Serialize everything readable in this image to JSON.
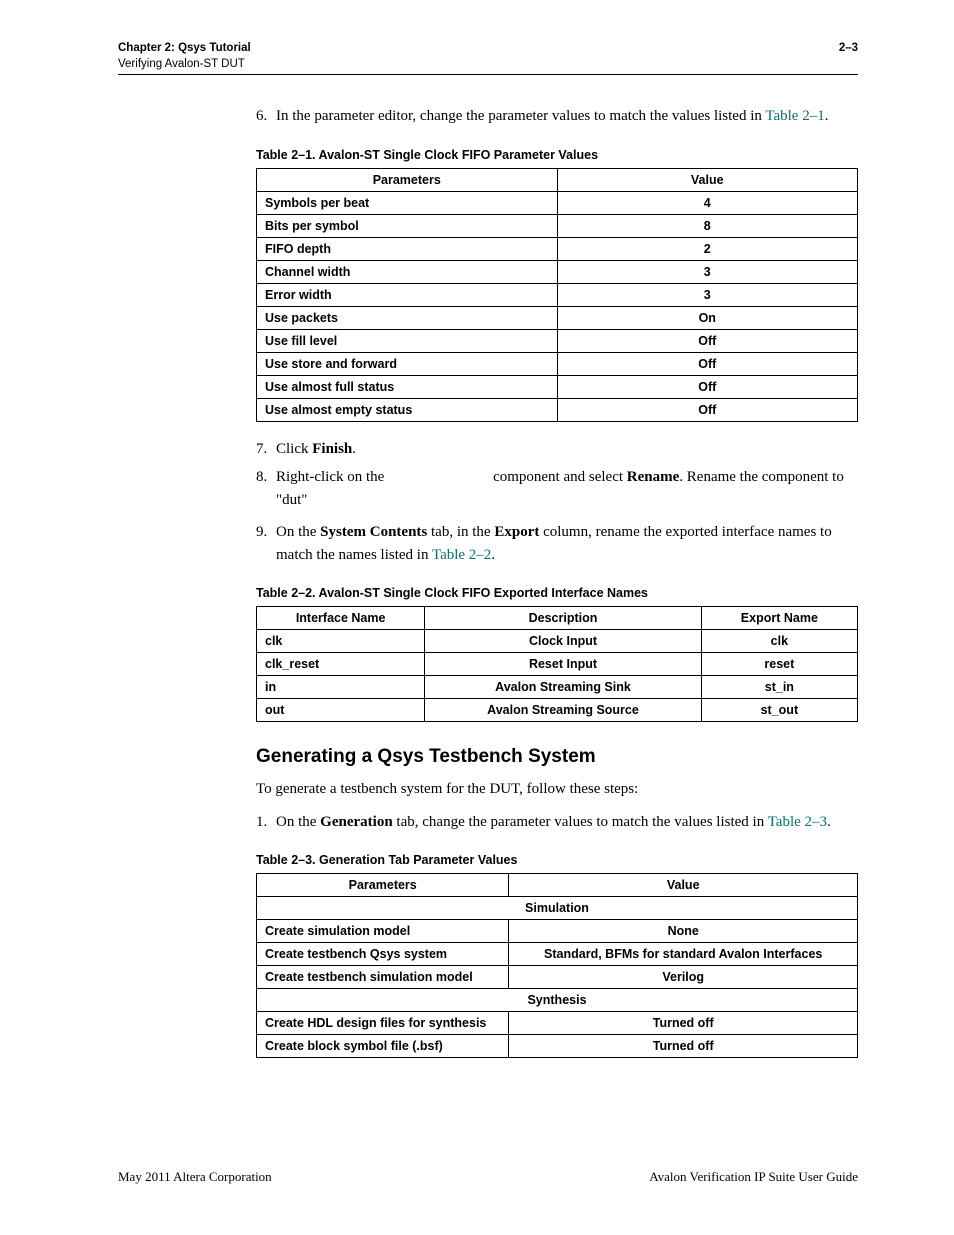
{
  "header": {
    "chapter_line": "Chapter 2: Qsys Tutorial",
    "sub_line": "Verifying Avalon-ST DUT",
    "page_number": "2–3"
  },
  "step6": {
    "num": "6.",
    "text_a": "In the parameter editor, change the parameter values to match the values listed in ",
    "link": "Table 2–1",
    "text_b": "."
  },
  "table1": {
    "caption": "Table 2–1.  Avalon-ST Single Clock FIFO Parameter Values",
    "headers": {
      "c1": "Parameters",
      "c2": "Value"
    },
    "rows": [
      {
        "param": "Symbols per beat",
        "value": "4"
      },
      {
        "param": "Bits per symbol",
        "value": "8"
      },
      {
        "param": "FIFO depth",
        "value": "2"
      },
      {
        "param": "Channel width",
        "value": "3"
      },
      {
        "param": "Error width",
        "value": "3"
      },
      {
        "param": "Use packets",
        "value": "On"
      },
      {
        "param": "Use fill level",
        "value": "Off"
      },
      {
        "param": "Use store and forward",
        "value": "Off"
      },
      {
        "param": "Use almost full status",
        "value": "Off"
      },
      {
        "param": "Use almost empty status",
        "value": "Off"
      }
    ]
  },
  "step7": {
    "num": "7.",
    "text_a": "Click ",
    "bold": "Finish",
    "text_b": "."
  },
  "step8": {
    "num": "8.",
    "text_a": "Right-click on the ",
    "gap": "                           ",
    "text_b": " component and select ",
    "bold": "Rename",
    "text_c": ". Rename the component to \"dut\""
  },
  "step9": {
    "num": "9.",
    "text_a": "On the ",
    "bold1": "System Contents",
    "text_b": " tab, in the ",
    "bold2": "Export",
    "text_c": " column, rename the exported interface names to match the names listed in ",
    "link": "Table 2–2",
    "text_d": "."
  },
  "table2": {
    "caption": "Table 2–2.  Avalon-ST Single Clock FIFO Exported Interface Names",
    "headers": {
      "c1": "Interface Name",
      "c2": "Description",
      "c3": "Export Name"
    },
    "rows": [
      {
        "iface": "clk",
        "desc": "Clock Input",
        "export": "clk"
      },
      {
        "iface": "clk_reset",
        "desc": "Reset Input",
        "export": "reset"
      },
      {
        "iface": "in",
        "desc": "Avalon Streaming Sink",
        "export": "st_in"
      },
      {
        "iface": "out",
        "desc": "Avalon Streaming Source",
        "export": "st_out"
      }
    ]
  },
  "section": {
    "heading": "Generating a Qsys Testbench System",
    "intro": "To generate a testbench system for the DUT, follow these steps:"
  },
  "step1b": {
    "num": "1.",
    "text_a": "On the ",
    "bold": "Generation",
    "text_b": " tab, change the parameter values to match the values listed in ",
    "link": "Table 2–3",
    "text_c": "."
  },
  "table3": {
    "caption": "Table 2–3.  Generation Tab Parameter Values",
    "headers": {
      "c1": "Parameters",
      "c2": "Value"
    },
    "section1": "Simulation",
    "rows_a": [
      {
        "param": "Create simulation model",
        "value": "None"
      },
      {
        "param": "Create testbench Qsys system",
        "value": "Standard, BFMs for standard Avalon Interfaces"
      },
      {
        "param": "Create testbench simulation model",
        "value": "Verilog"
      }
    ],
    "section2": "Synthesis",
    "rows_b": [
      {
        "param": "Create HDL design files for synthesis",
        "value": "Turned off"
      },
      {
        "param": "Create block symbol file (.bsf)",
        "value": "Turned off"
      }
    ]
  },
  "footer": {
    "left": "May 2011   Altera Corporation",
    "right": "Avalon Verification IP Suite User Guide"
  }
}
